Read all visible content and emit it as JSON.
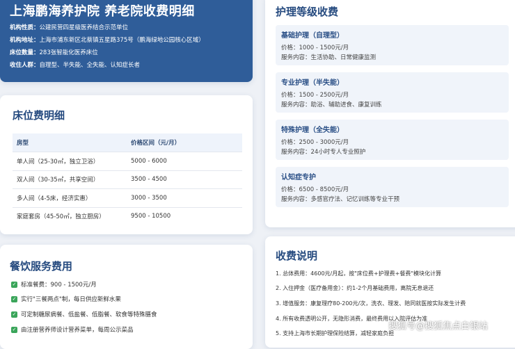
{
  "header": {
    "title": "上海鹏海养护院 养老院收费明细",
    "info": [
      {
        "label": "机构性质：",
        "value": "公建民营四星级医养结合示范单位"
      },
      {
        "label": "机构地址：",
        "value": "上海市浦东新区北蔡镇五星路375号（鹏海绿地公园核心区域）"
      },
      {
        "label": "床位数量：",
        "value": "283张智能化医养床位"
      },
      {
        "label": "收住人群：",
        "value": "自理型、半失能、全失能、认知症长者"
      }
    ]
  },
  "bed": {
    "title": "床位费明细",
    "headers": [
      "房型",
      "价格区间（元/月）"
    ],
    "rows": [
      {
        "type": "单人间（25-30㎡，独立卫浴）",
        "price": "5000 - 6000"
      },
      {
        "type": "双人间（30-35㎡，共享空间）",
        "price": "3500 - 4500"
      },
      {
        "type": "多人间（4-5床，经济实惠）",
        "price": "3000 - 3500"
      },
      {
        "type": "家庭套房（45-50㎡，独立厨房）",
        "price": "9500 - 10500"
      }
    ]
  },
  "meal": {
    "title": "餐饮服务费用",
    "items": [
      "标准餐费：900 - 1500元/月",
      "实行\"三餐两点\"制，每日供应新鲜水果",
      "可定制糖尿病餐、低盐餐、低脂餐、软食等特殊膳食",
      "由注册营养师设计营养菜单，每周公示菜品"
    ]
  },
  "nursing": {
    "title": "护理等级收费",
    "levels": [
      {
        "name": "基础护理（自理型）",
        "price": "价格：1000 - 1500元/月",
        "service": "服务内容：生活协助、日常健康监测"
      },
      {
        "name": "专业护理（半失能）",
        "price": "价格：1500 - 2500元/月",
        "service": "服务内容：助浴、辅助进食、康复训练"
      },
      {
        "name": "特殊护理（全失能）",
        "price": "价格：2500 - 3000元/月",
        "service": "服务内容：24小时专人专业照护"
      },
      {
        "name": "认知症专护",
        "price": "价格：6500 - 8500元/月",
        "service": "服务内容：多感官疗法、记忆训练等专业干预"
      }
    ]
  },
  "fee": {
    "title": "收费说明",
    "items": [
      "1. 总体费用：4600元/月起，按\"床位费+护理费+餐费\"模块化计算",
      "2. 入住押金（医疗备用金）：约1-2个月基础费用，离院无息退还",
      "3. 增值服务：康复理疗80-200元/次，洗衣、理发、陪同就医按实际发生计费",
      "4. 所有收费透明公开，无隐形消费，最终费用以入院评估为准",
      "5. 支持上海市长期护理保险结算，减轻家庭负担"
    ]
  },
  "watermark": "搜狐号@搜狐焦点白银站",
  "colors": {
    "header_bg": "#2f5d99",
    "title_text": "#254a7f",
    "check": "#3aa55a"
  }
}
